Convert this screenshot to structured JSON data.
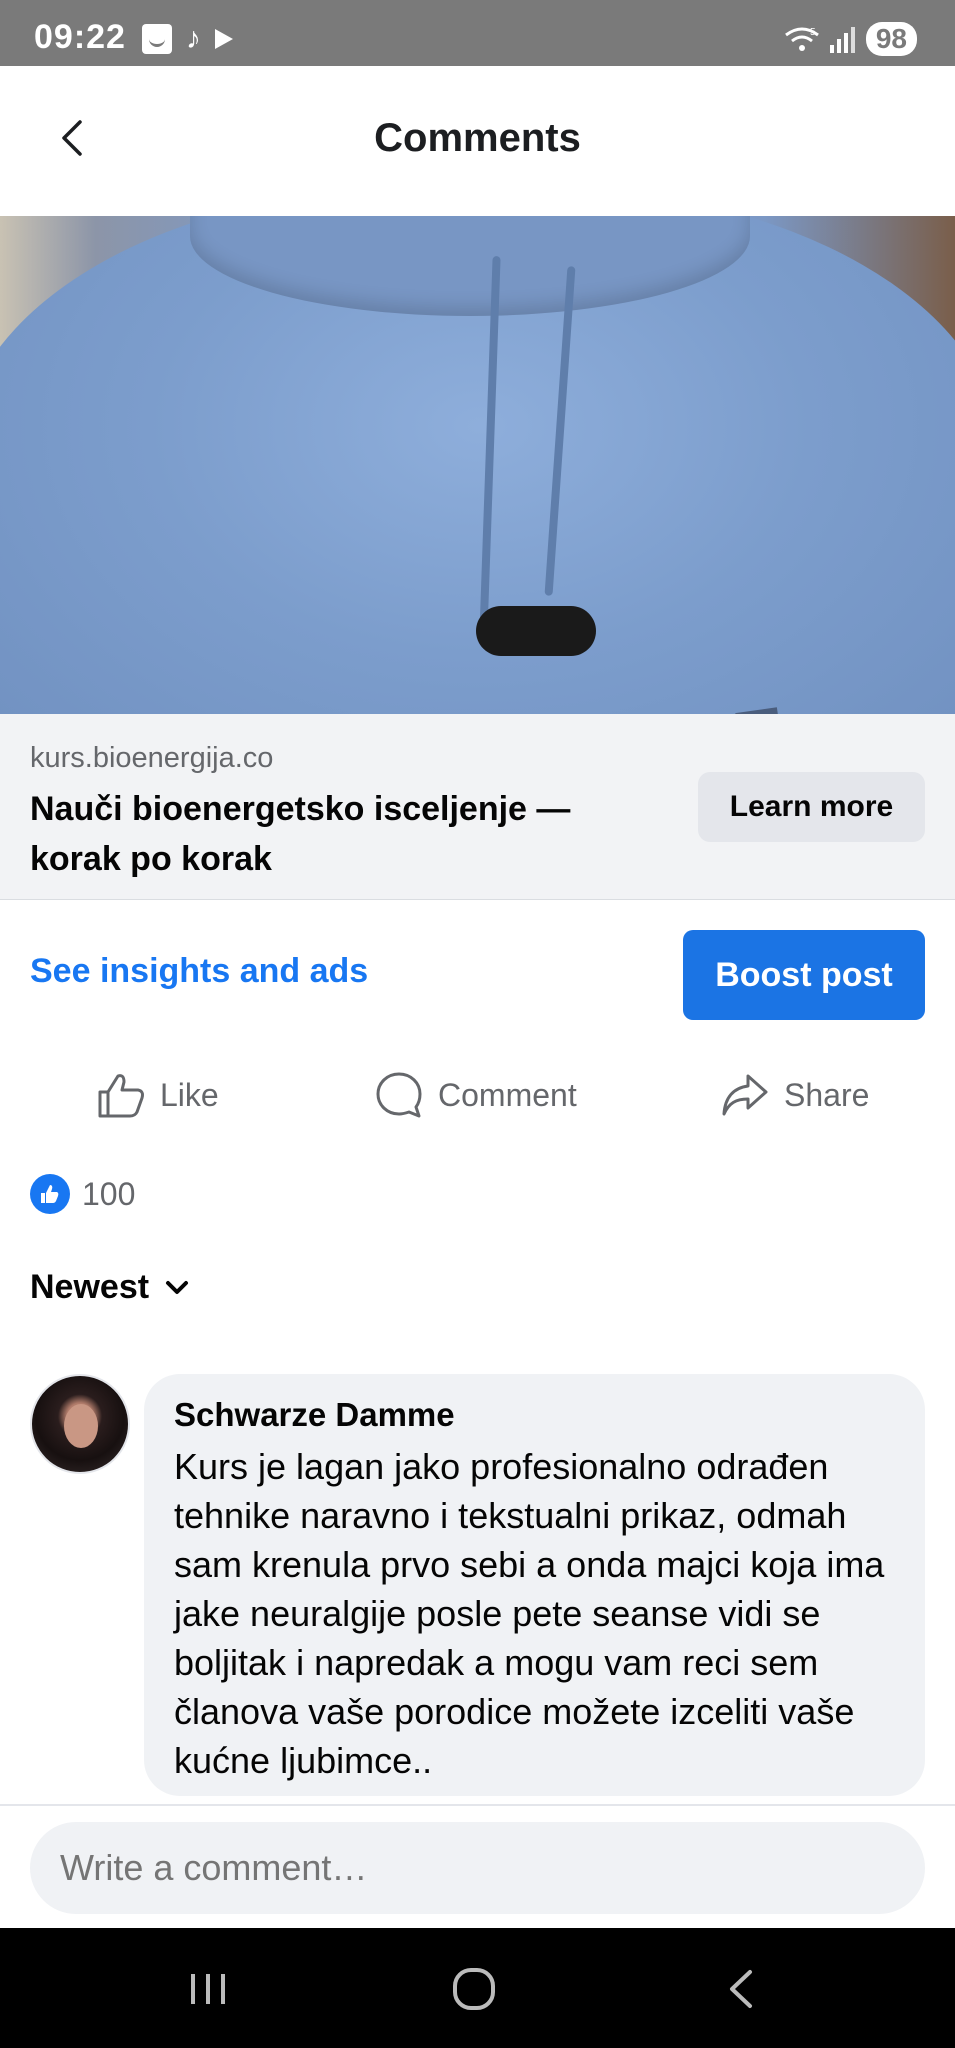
{
  "status_bar": {
    "time": "09:22",
    "battery": "98",
    "network": "5"
  },
  "header": {
    "title": "Comments"
  },
  "link_preview": {
    "domain": "kurs.bioenergija.co",
    "title": "Nauči bioenergetsko isceljenje — korak po korak",
    "cta_label": "Learn more"
  },
  "insights": {
    "link_label": "See insights and ads",
    "boost_label": "Boost post"
  },
  "actions": {
    "like": "Like",
    "comment": "Comment",
    "share": "Share"
  },
  "reactions": {
    "count": "100"
  },
  "sort": {
    "label": "Newest"
  },
  "comment": {
    "author": "Schwarze Damme",
    "text": "Kurs je lagan jako profesionalno odrađen tehnike naravno i tekstualni prikaz, odmah sam krenula prvo sebi a onda majci koja ima jake neuralgije posle pete seanse vidi se boljitak i napredak a mogu vam reci sem članova vaše porodice možete izceliti vaše kućne ljubimce.."
  },
  "composer": {
    "placeholder": "Write a comment…"
  },
  "colors": {
    "accent": "#1877f2",
    "boost": "#1b74e4",
    "status_bar": "#7a7a7a"
  }
}
